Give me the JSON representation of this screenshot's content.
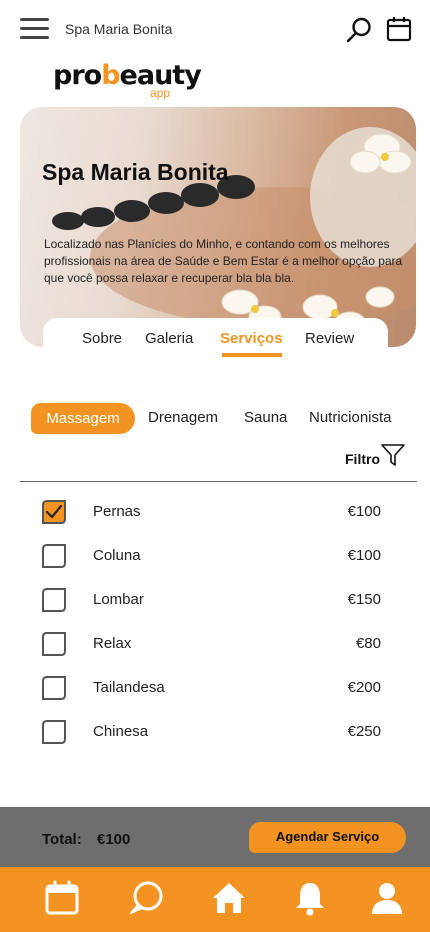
{
  "header": {
    "title": "Spa Maria Bonita",
    "icons": [
      "menu-icon",
      "search-icon",
      "calendar-icon"
    ]
  },
  "logo": {
    "text_pre": "pro",
    "text_accent": "b",
    "text_post": "eauty",
    "sub": "app"
  },
  "hero": {
    "title": "Spa Maria Bonita",
    "description": "Localizado nas Planícies do Minho, e contando com os melhores profissionais na área de Saúde e Bem Estar é a melhor opção para que você possa relaxar e recuperar bla bla bla."
  },
  "tabs": [
    {
      "label": "Sobre"
    },
    {
      "label": "Galeria"
    },
    {
      "label": "Serviços",
      "active": true
    },
    {
      "label": "Review"
    }
  ],
  "categories": [
    {
      "label": "Massagem",
      "active": true
    },
    {
      "label": "Drenagem"
    },
    {
      "label": "Sauna"
    },
    {
      "label": "Nutricionista"
    }
  ],
  "filter": {
    "label": "Filtro",
    "icon": "filter-icon"
  },
  "services": [
    {
      "name": "Pernas",
      "price": "€100",
      "checked": true
    },
    {
      "name": "Coluna",
      "price": "€100",
      "checked": false
    },
    {
      "name": "Lombar",
      "price": "€150",
      "checked": false
    },
    {
      "name": "Relax",
      "price": "€80",
      "checked": false
    },
    {
      "name": "Tailandesa",
      "price": "€200",
      "checked": false
    },
    {
      "name": "Chinesa",
      "price": "€250",
      "checked": false
    }
  ],
  "footer": {
    "total_label": "Total:",
    "total_value": "€100",
    "cta_label": "Agendar Serviço"
  },
  "bottom_nav": [
    "calendar-icon",
    "chat-icon",
    "home-icon",
    "bell-icon",
    "user-icon"
  ],
  "colors": {
    "accent": "#f39422",
    "footer_gray": "#6e6e6e"
  }
}
